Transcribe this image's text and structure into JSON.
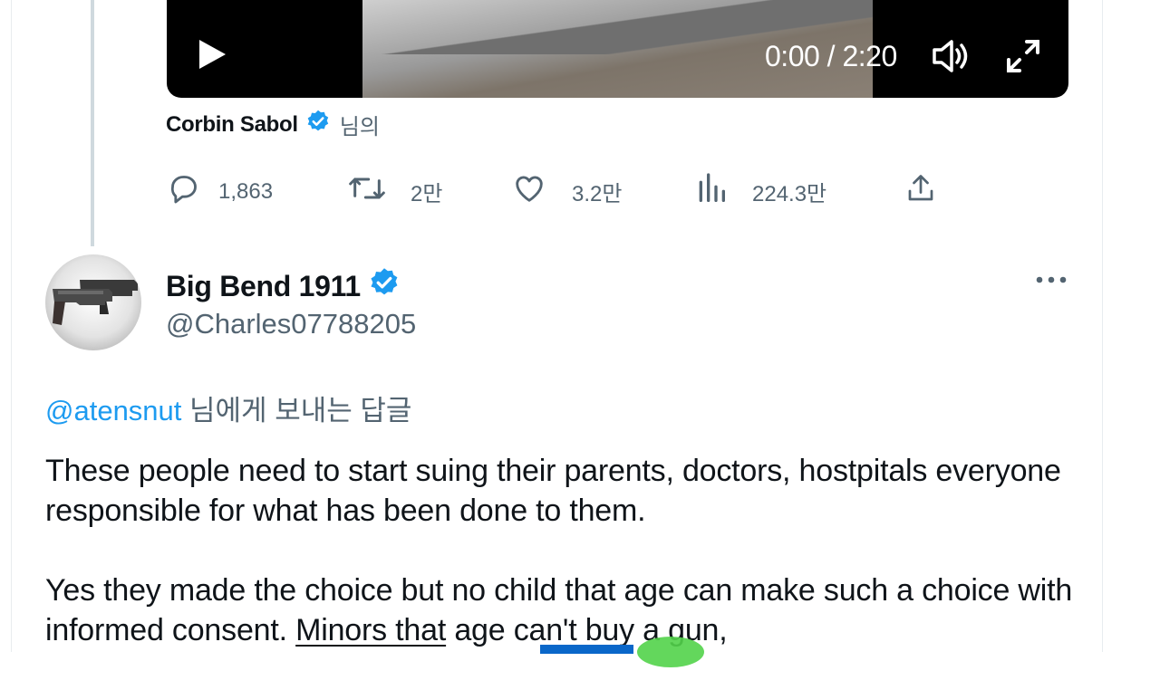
{
  "video": {
    "time": "0:00 / 2:20",
    "icons": {
      "play": "play-icon",
      "volume": "volume-icon",
      "fullscreen": "fullscreen-icon"
    }
  },
  "quoted_caption": {
    "author": "Corbin Sabol",
    "suffix": "님의"
  },
  "actions": {
    "replies": "1,863",
    "retweets": "2만",
    "likes": "3.2만",
    "views": "224.3만"
  },
  "tweet": {
    "author_name": "Big Bend 1911",
    "handle": "@Charles07788205",
    "reply_mention": "@atensnut",
    "reply_suffix": " 님에게 보내는 답글",
    "paragraph1": "These people need to start suing their parents, doctors, hostpitals everyone responsible for what has been done to them.",
    "paragraph2_a": "Yes they made the choice but no child that age can make such a choice with informed consent.  ",
    "paragraph2_b": "Minors that",
    "paragraph2_c": " age can't buy a gun,"
  },
  "colors": {
    "accent": "#1d9bf0",
    "muted": "#536471",
    "text": "#0f1419",
    "verified": "#1d9bf0"
  }
}
